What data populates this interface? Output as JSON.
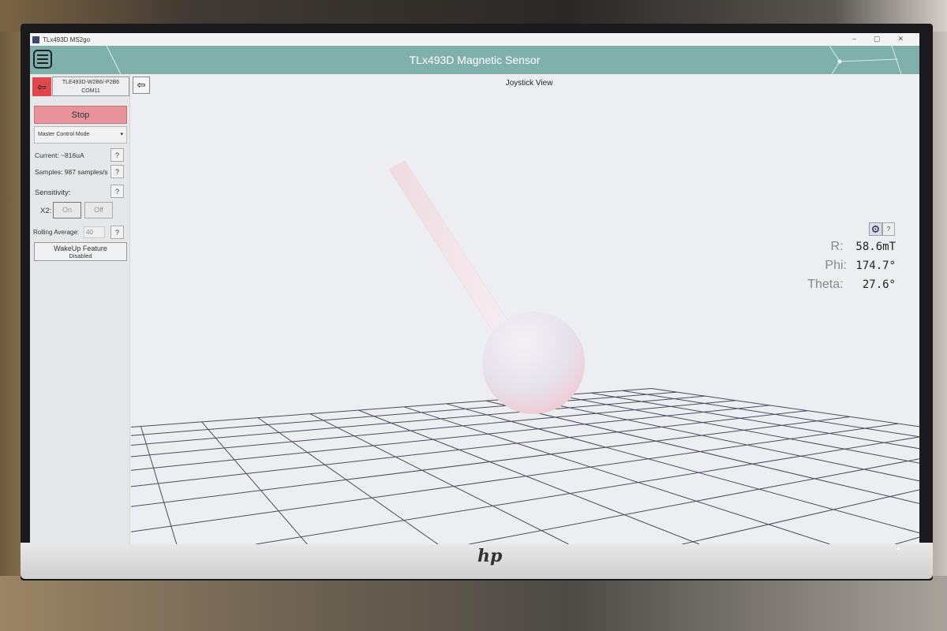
{
  "window": {
    "title": "TLx493D MS2go",
    "controls": [
      "–",
      "▢",
      "✕"
    ]
  },
  "header": {
    "title": "TLx493D Magnetic Sensor"
  },
  "sidebar": {
    "device_name": "TLE493D-W2B6/-P2B6",
    "device_port": "COM11",
    "stop_label": "Stop",
    "mode_select": "Master Control Mode",
    "current": "Current: ~816uA",
    "samples": "Samples: 987 samples/s",
    "sensitivity": "Sensitivity:",
    "x2_label": "X2:",
    "on_label": "On",
    "off_label": "Off",
    "rolling_label": "Rolling Average:",
    "rolling_value": "40",
    "wakeup_title": "WakeUp Feature",
    "wakeup_status": "Disabled",
    "help": "?"
  },
  "view": {
    "title": "Joystick View",
    "readout": {
      "r_label": "R:",
      "r_value": "58.6mT",
      "phi_label": "Phi:",
      "phi_value": "174.7°",
      "theta_label": "Theta:",
      "theta_value": "27.6°"
    }
  },
  "colors": {
    "accent": "#7fb0ac",
    "stop": "#e8929c",
    "back": "#e0474c"
  },
  "icons": {
    "menu": "hamburger-icon",
    "back": "arrow-left-icon",
    "settings": "gear-icon"
  }
}
